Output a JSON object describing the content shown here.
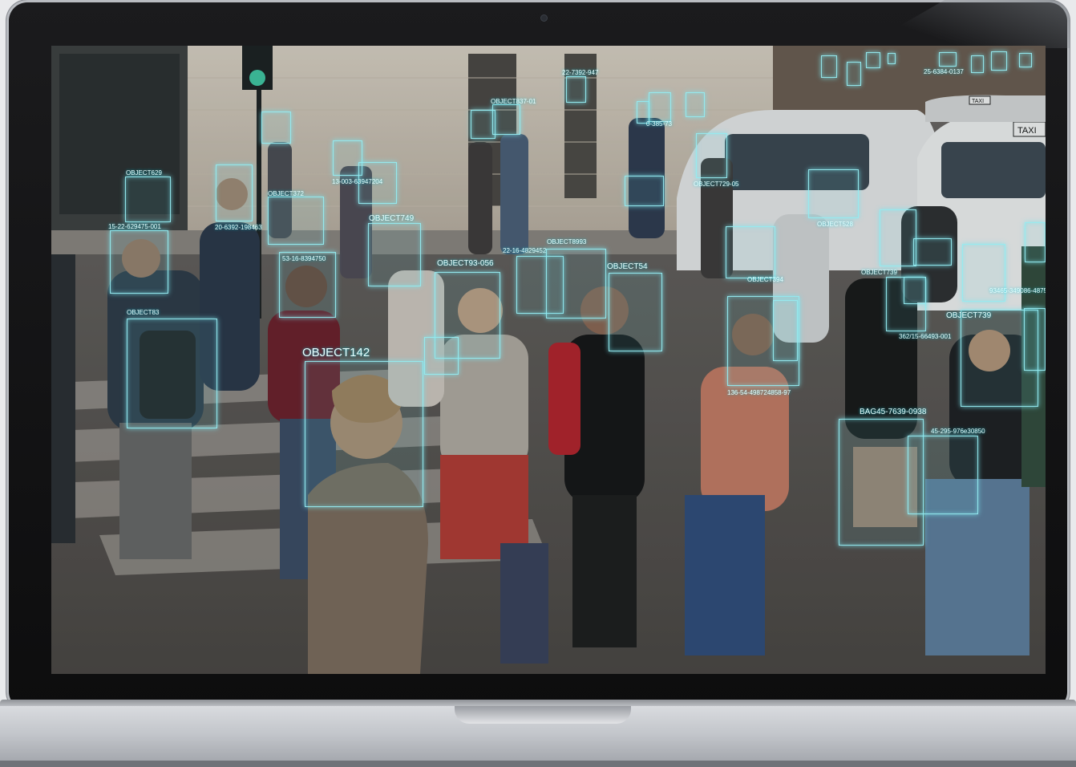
{
  "device": {
    "type": "laptop"
  },
  "scene": {
    "subject": "street-crowd-face-detection"
  },
  "labels": {
    "l01": "OBJECT629",
    "l02": "15-22-629475-001",
    "l03": "OBJECT83",
    "l04": "20-6392-198463",
    "l05": "OBJECT372",
    "l06": "13-003-63947204",
    "l07": "OBJECT749",
    "l08": "53-16-8394750",
    "l09": "OBJECT142",
    "l10": "OBJECT93-056",
    "l11": "22-16-4829452",
    "l12": "OBJECT8993",
    "l13": "OBJECT54",
    "l14": "OBJECT837-01",
    "l15": "22-7392-947",
    "l16": "0-385-73",
    "l17": "OBJECT729-05",
    "l18": "OBJECT528",
    "l19": "OBJECT394",
    "l20": "OBJECT739",
    "l21": "136-54-498724858-97",
    "l22": "362/15-66493-001",
    "l23": "OBJECT739",
    "l24": "93465-349086-4875",
    "l25": "BAG45-7639-0938",
    "l26": "45-295-976e30850",
    "l27": "25-6384-0137"
  },
  "colors": {
    "box_stroke": "#96ebf0",
    "label_text": "#e8ffff"
  }
}
